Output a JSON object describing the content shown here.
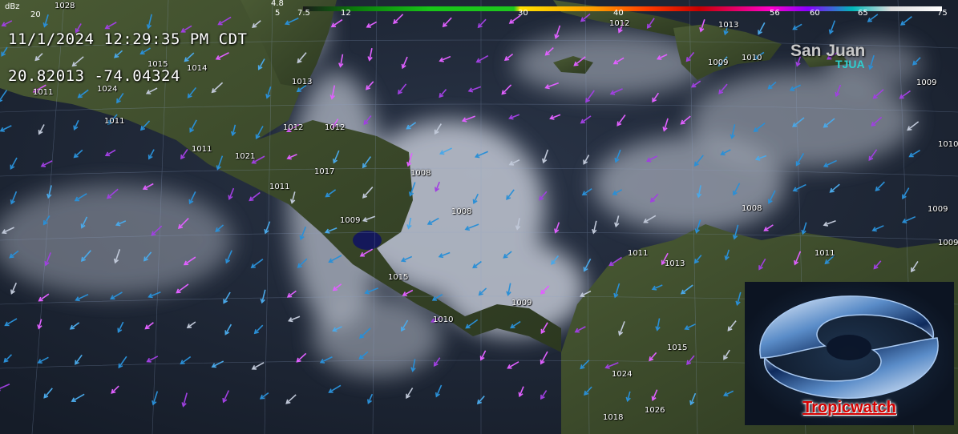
{
  "overlay": {
    "timestamp": "11/1/2024  12:29:35 PM CDT",
    "coordinates": "20.82013  -74.04324",
    "station": "San Juan",
    "station_code": "TJUA"
  },
  "colorbar": {
    "unit": "dBz",
    "ticks": [
      "4.8",
      "5",
      "7.5",
      "12",
      "30",
      "40",
      "56",
      "60",
      "65",
      "75"
    ],
    "corner_label": "20"
  },
  "pressure_labels": [
    "1028",
    "1015",
    "1014",
    "1011",
    "1024",
    "1011",
    "1011",
    "1021",
    "1011",
    "1013",
    "1012",
    "1012",
    "1017",
    "1008",
    "1009",
    "1008",
    "1015",
    "1010",
    "1009",
    "1012",
    "1013",
    "1009",
    "1010",
    "1009",
    "1010",
    "1008",
    "1009",
    "1009",
    "1011",
    "1011",
    "1013",
    "1015",
    "1024",
    "1018",
    "1026"
  ],
  "logo": {
    "text": "Tropicwatch"
  },
  "colors": {
    "ocean": "#1f2838",
    "land": "#3a4a2c",
    "cloud": "#c8ccd6",
    "wind_blue": "#2a8fd6",
    "wind_purple": "#a040e0",
    "wind_magenta": "#e060ff",
    "logo_red": "#d40000"
  }
}
